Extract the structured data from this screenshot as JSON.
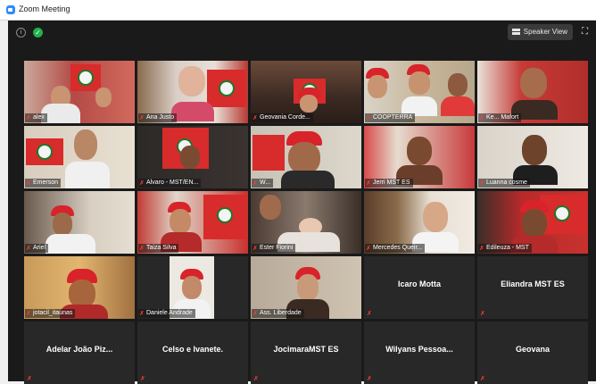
{
  "window": {
    "title": "Zoom Meeting"
  },
  "toolbar": {
    "speaker_view_label": "Speaker View",
    "info_icon": "info-icon",
    "security_icon": "shield-icon",
    "fullscreen_icon": "fullscreen-icon"
  },
  "tiles": [
    {
      "name": "alex"
    },
    {
      "name": "Ana Justo"
    },
    {
      "name": "Geovania Corde..."
    },
    {
      "name": "COOPTERRA"
    },
    {
      "name": "Ke... Mafort"
    },
    {
      "name": "Emerson"
    },
    {
      "name": "Alvaro - MST/EN..."
    },
    {
      "name": "W..."
    },
    {
      "name": "Jerri MST ES"
    },
    {
      "name": "Luanna cosme"
    },
    {
      "name": "Ariel"
    },
    {
      "name": "Taiza Silva"
    },
    {
      "name": "Ester Fiorini"
    },
    {
      "name": "Mercedes Queir..."
    },
    {
      "name": "Edileuza - MST"
    },
    {
      "name": "jotacil_itaunas"
    },
    {
      "name": "Daniele Andrade"
    },
    {
      "name": "Ass. Liberdade"
    },
    {
      "name": "Icaro Motta"
    },
    {
      "name": "Eliandra MST ES"
    },
    {
      "name": "Adelar João Piz..."
    },
    {
      "name": "Celso e Ivanete."
    },
    {
      "name": "JocimaraMST ES"
    },
    {
      "name": "Wilyans Pessoa..."
    },
    {
      "name": "Geovana"
    }
  ],
  "colors": {
    "active_speaker_border": "#c8d63a",
    "muted_mic": "#ff3b30",
    "window_bg": "#1a1a1a",
    "tile_blank_bg": "#282828"
  }
}
